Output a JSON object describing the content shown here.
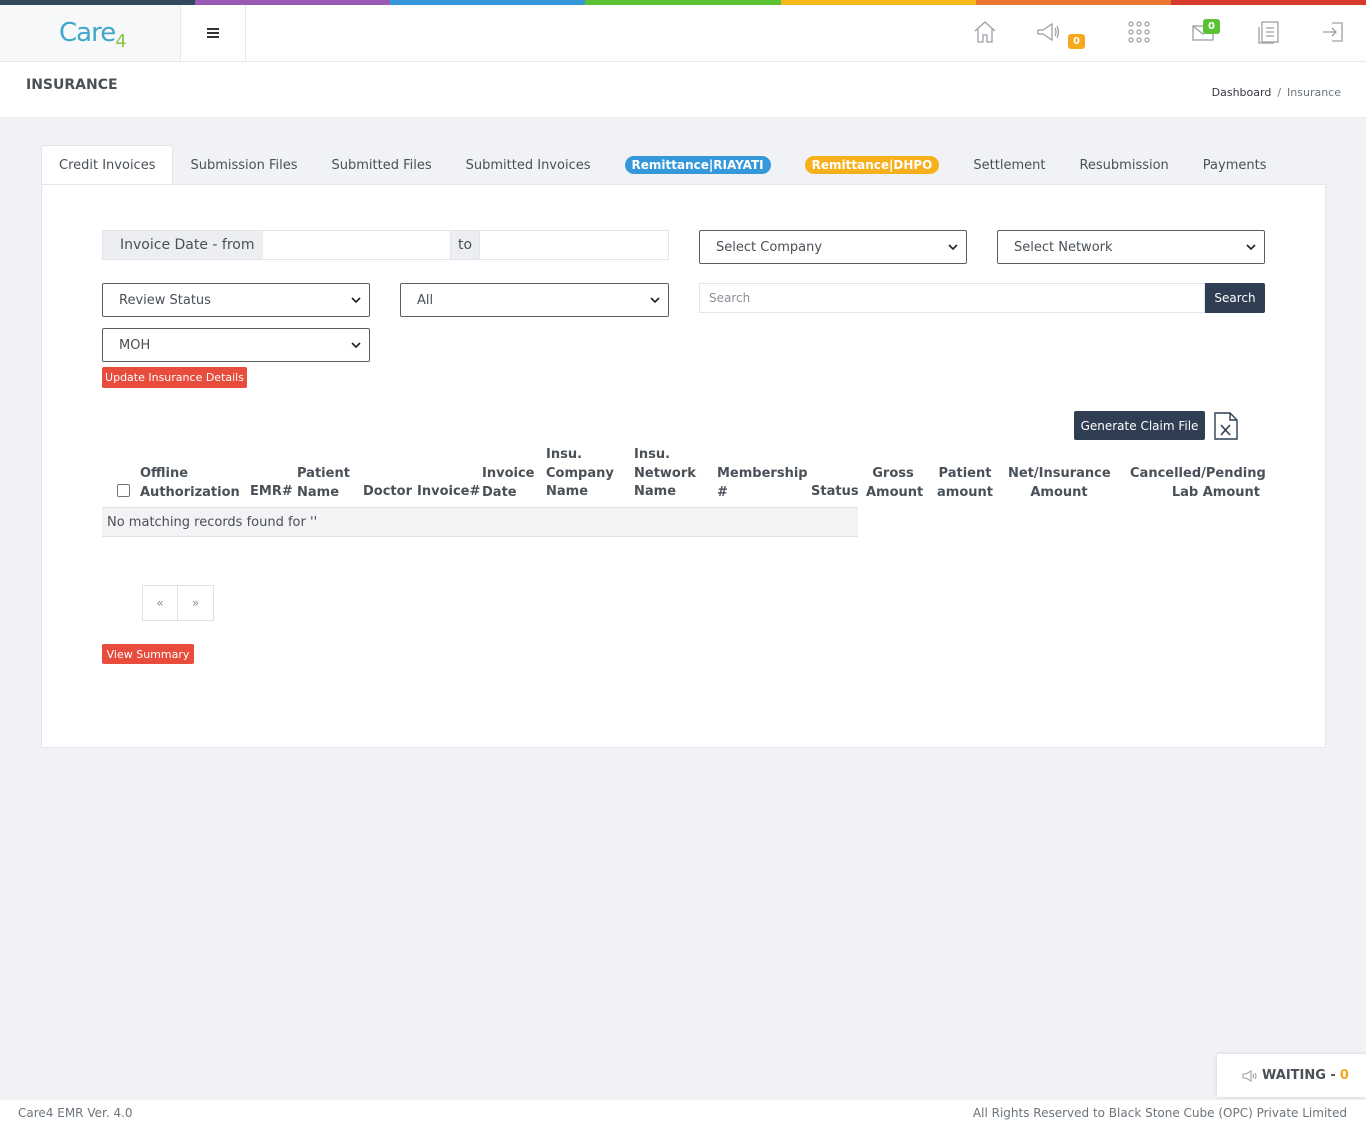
{
  "brand": {
    "name": "Care",
    "suffix": "4"
  },
  "colors": {
    "top_stripes": [
      "#34495e",
      "#9b59b6",
      "#3498db",
      "#5bc236",
      "#f5b91b",
      "#e8742f",
      "#d63a2a"
    ],
    "primary_dark": "#2f3e52",
    "danger": "#e74c3c",
    "riayati_pill": "#3498db",
    "dhpo_pill": "#f5b01b",
    "notification_badge": "#f4a81d",
    "mail_badge": "#5bc236"
  },
  "header": {
    "nav_icons": [
      "home-icon",
      "megaphone-icon",
      "apps-grid-icon",
      "mail-icon",
      "report-icon",
      "logout-icon"
    ],
    "announcements_count": "0",
    "mail_count": "0"
  },
  "page": {
    "title": "INSURANCE",
    "breadcrumb": [
      {
        "label": "Dashboard"
      },
      {
        "label": "Insurance"
      }
    ]
  },
  "tabs": [
    {
      "label": "Credit Invoices",
      "active": true
    },
    {
      "label": "Submission Files"
    },
    {
      "label": "Submitted Files"
    },
    {
      "label": "Submitted Invoices"
    },
    {
      "label": "Remittance|RIAYATI",
      "pill": true
    },
    {
      "label": "Remittance|DHPO",
      "pill": true
    },
    {
      "label": "Settlement"
    },
    {
      "label": "Resubmission"
    },
    {
      "label": "Payments"
    }
  ],
  "filters": {
    "date_from_label": "Invoice Date - from",
    "date_to_label": "to",
    "date_from_value": "",
    "date_to_value": "",
    "company_select": "Select Company",
    "network_select": "Select Network",
    "review_status_select": "Review Status",
    "all_select": "All",
    "moh_select": "MOH",
    "search_placeholder": "Search",
    "search_button": "Search",
    "update_button": "Update Insurance Details"
  },
  "actions": {
    "generate_claim": "Generate Claim File"
  },
  "table": {
    "headers": [
      {
        "lines": [
          "Offline",
          "Authorization"
        ]
      },
      {
        "lines": [
          "EMR#"
        ]
      },
      {
        "lines": [
          "Patient",
          "Name"
        ]
      },
      {
        "lines": [
          "Doctor"
        ]
      },
      {
        "lines": [
          "Invoice#"
        ]
      },
      {
        "lines": [
          "Invoice",
          "Date"
        ]
      },
      {
        "lines": [
          "Insu.",
          "Company",
          "Name"
        ]
      },
      {
        "lines": [
          "Insu.",
          "Network",
          "Name"
        ]
      },
      {
        "lines": [
          "Membership",
          "#"
        ]
      },
      {
        "lines": [
          "Status"
        ]
      },
      {
        "lines": [
          "Gross",
          "Amount"
        ]
      },
      {
        "lines": [
          "Patient",
          "amount"
        ]
      },
      {
        "lines": [
          "Net/Insurance",
          "Amount"
        ]
      },
      {
        "lines": [
          "Cancelled/Pending",
          "Lab Amount"
        ]
      }
    ],
    "empty_message": "No matching records found for ''"
  },
  "pagination": {
    "prev": "«",
    "next": "»"
  },
  "summary_button": "View Summary",
  "waiting": {
    "label": "WAITING -",
    "count": "0"
  },
  "footer": {
    "version": "Care4 EMR Ver. 4.0",
    "rights": "All Rights Reserved to Black Stone Cube (OPC) Private Limited"
  }
}
